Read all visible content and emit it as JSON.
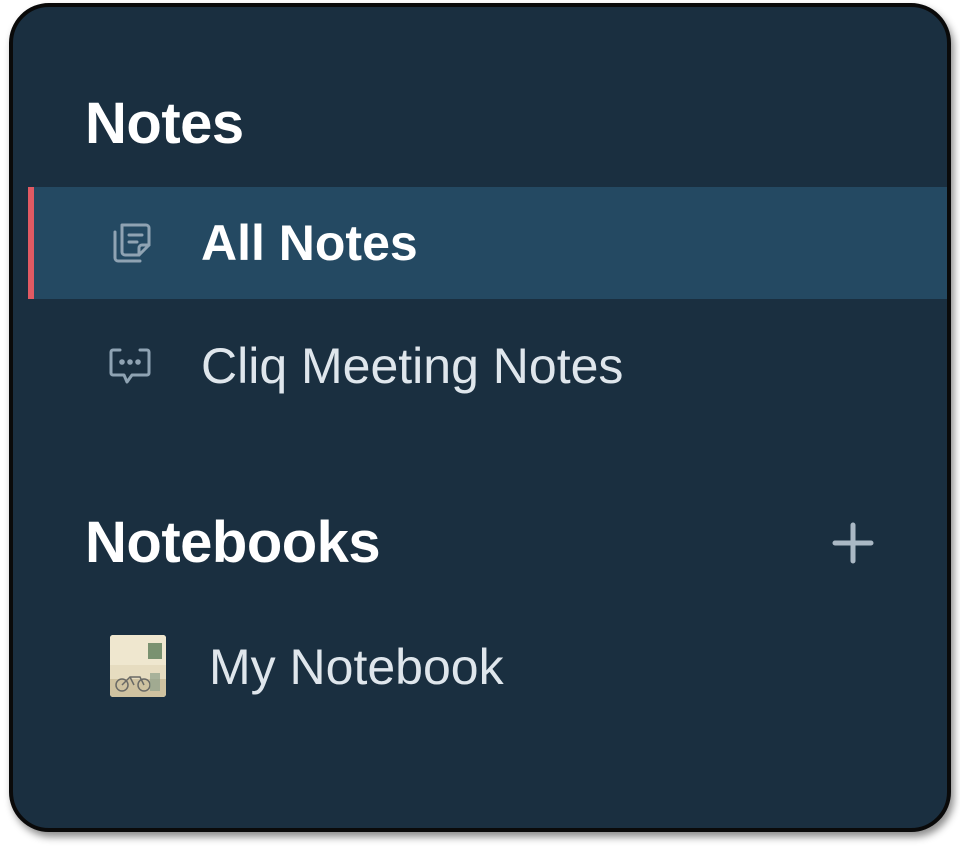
{
  "sidebar": {
    "notes_section": {
      "title": "Notes",
      "items": [
        {
          "label": "All Notes",
          "icon": "notes-stack-icon",
          "active": true
        },
        {
          "label": "Cliq Meeting Notes",
          "icon": "chat-bubble-icon",
          "active": false
        }
      ]
    },
    "notebooks_section": {
      "title": "Notebooks",
      "add_icon": "plus-icon",
      "items": [
        {
          "label": "My Notebook",
          "icon": "notebook-cover-thumbnail"
        }
      ]
    }
  },
  "colors": {
    "background": "#1a2f40",
    "active_background": "#244962",
    "active_indicator": "#e05a63",
    "text_primary": "#ffffff",
    "text_secondary": "#dfe6ec",
    "icon": "#8fa3b3"
  }
}
